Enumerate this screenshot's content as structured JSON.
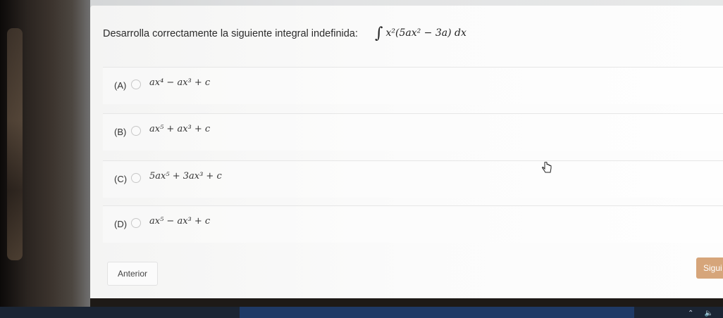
{
  "question": {
    "prompt": "Desarrolla correctamente la siguiente integral indefinida:",
    "integral_sign": "∫",
    "integrand": "x²(5ax² − 3a) dx"
  },
  "options": [
    {
      "letter": "(A)",
      "formula": "ax⁴ − ax³ + c"
    },
    {
      "letter": "(B)",
      "formula": "ax⁵ + ax³ + c"
    },
    {
      "letter": "(C)",
      "formula": "5ax⁵ + 3ax³ + c"
    },
    {
      "letter": "(D)",
      "formula": "ax⁵ − ax³ + c"
    }
  ],
  "buttons": {
    "previous": "Anterior",
    "next": "Sigui"
  },
  "colors": {
    "next_button": "#d6a57a",
    "card": "#fbfbfb",
    "taskbar": "#1f3a66"
  },
  "icons": {
    "cursor": "hand-pointer-icon",
    "radio": "radio-circle-icon"
  }
}
